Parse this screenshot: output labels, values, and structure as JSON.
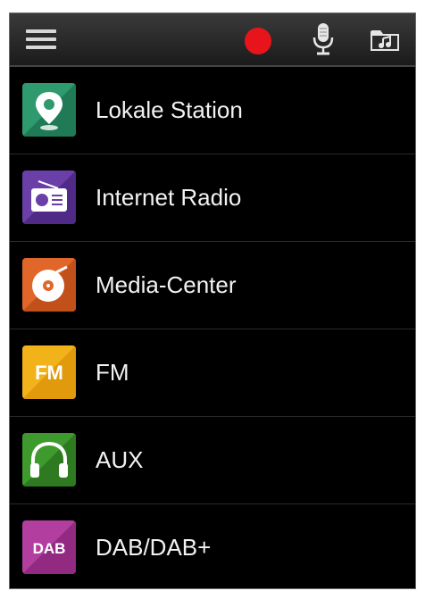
{
  "toolbar": {
    "menu_icon": "hamburger-menu-icon",
    "record_icon": "record-icon",
    "mic_icon": "microphone-icon",
    "folder_icon": "music-folder-icon",
    "record_color": "#e8141c"
  },
  "menu": {
    "items": [
      {
        "label": "Lokale Station",
        "icon": "location-pin-icon",
        "color": "#2e9a6e"
      },
      {
        "label": "Internet Radio",
        "icon": "radio-icon",
        "color": "#6a3fa8"
      },
      {
        "label": "Media-Center",
        "icon": "disc-icon",
        "color": "#e0662a"
      },
      {
        "label": "FM",
        "icon": "fm-icon",
        "icon_text": "FM",
        "color": "#f2b31a"
      },
      {
        "label": "AUX",
        "icon": "headphones-icon",
        "color": "#3f9a2e"
      },
      {
        "label": "DAB/DAB+",
        "icon": "dab-icon",
        "icon_text": "DAB",
        "color": "#b23fa0"
      }
    ]
  }
}
